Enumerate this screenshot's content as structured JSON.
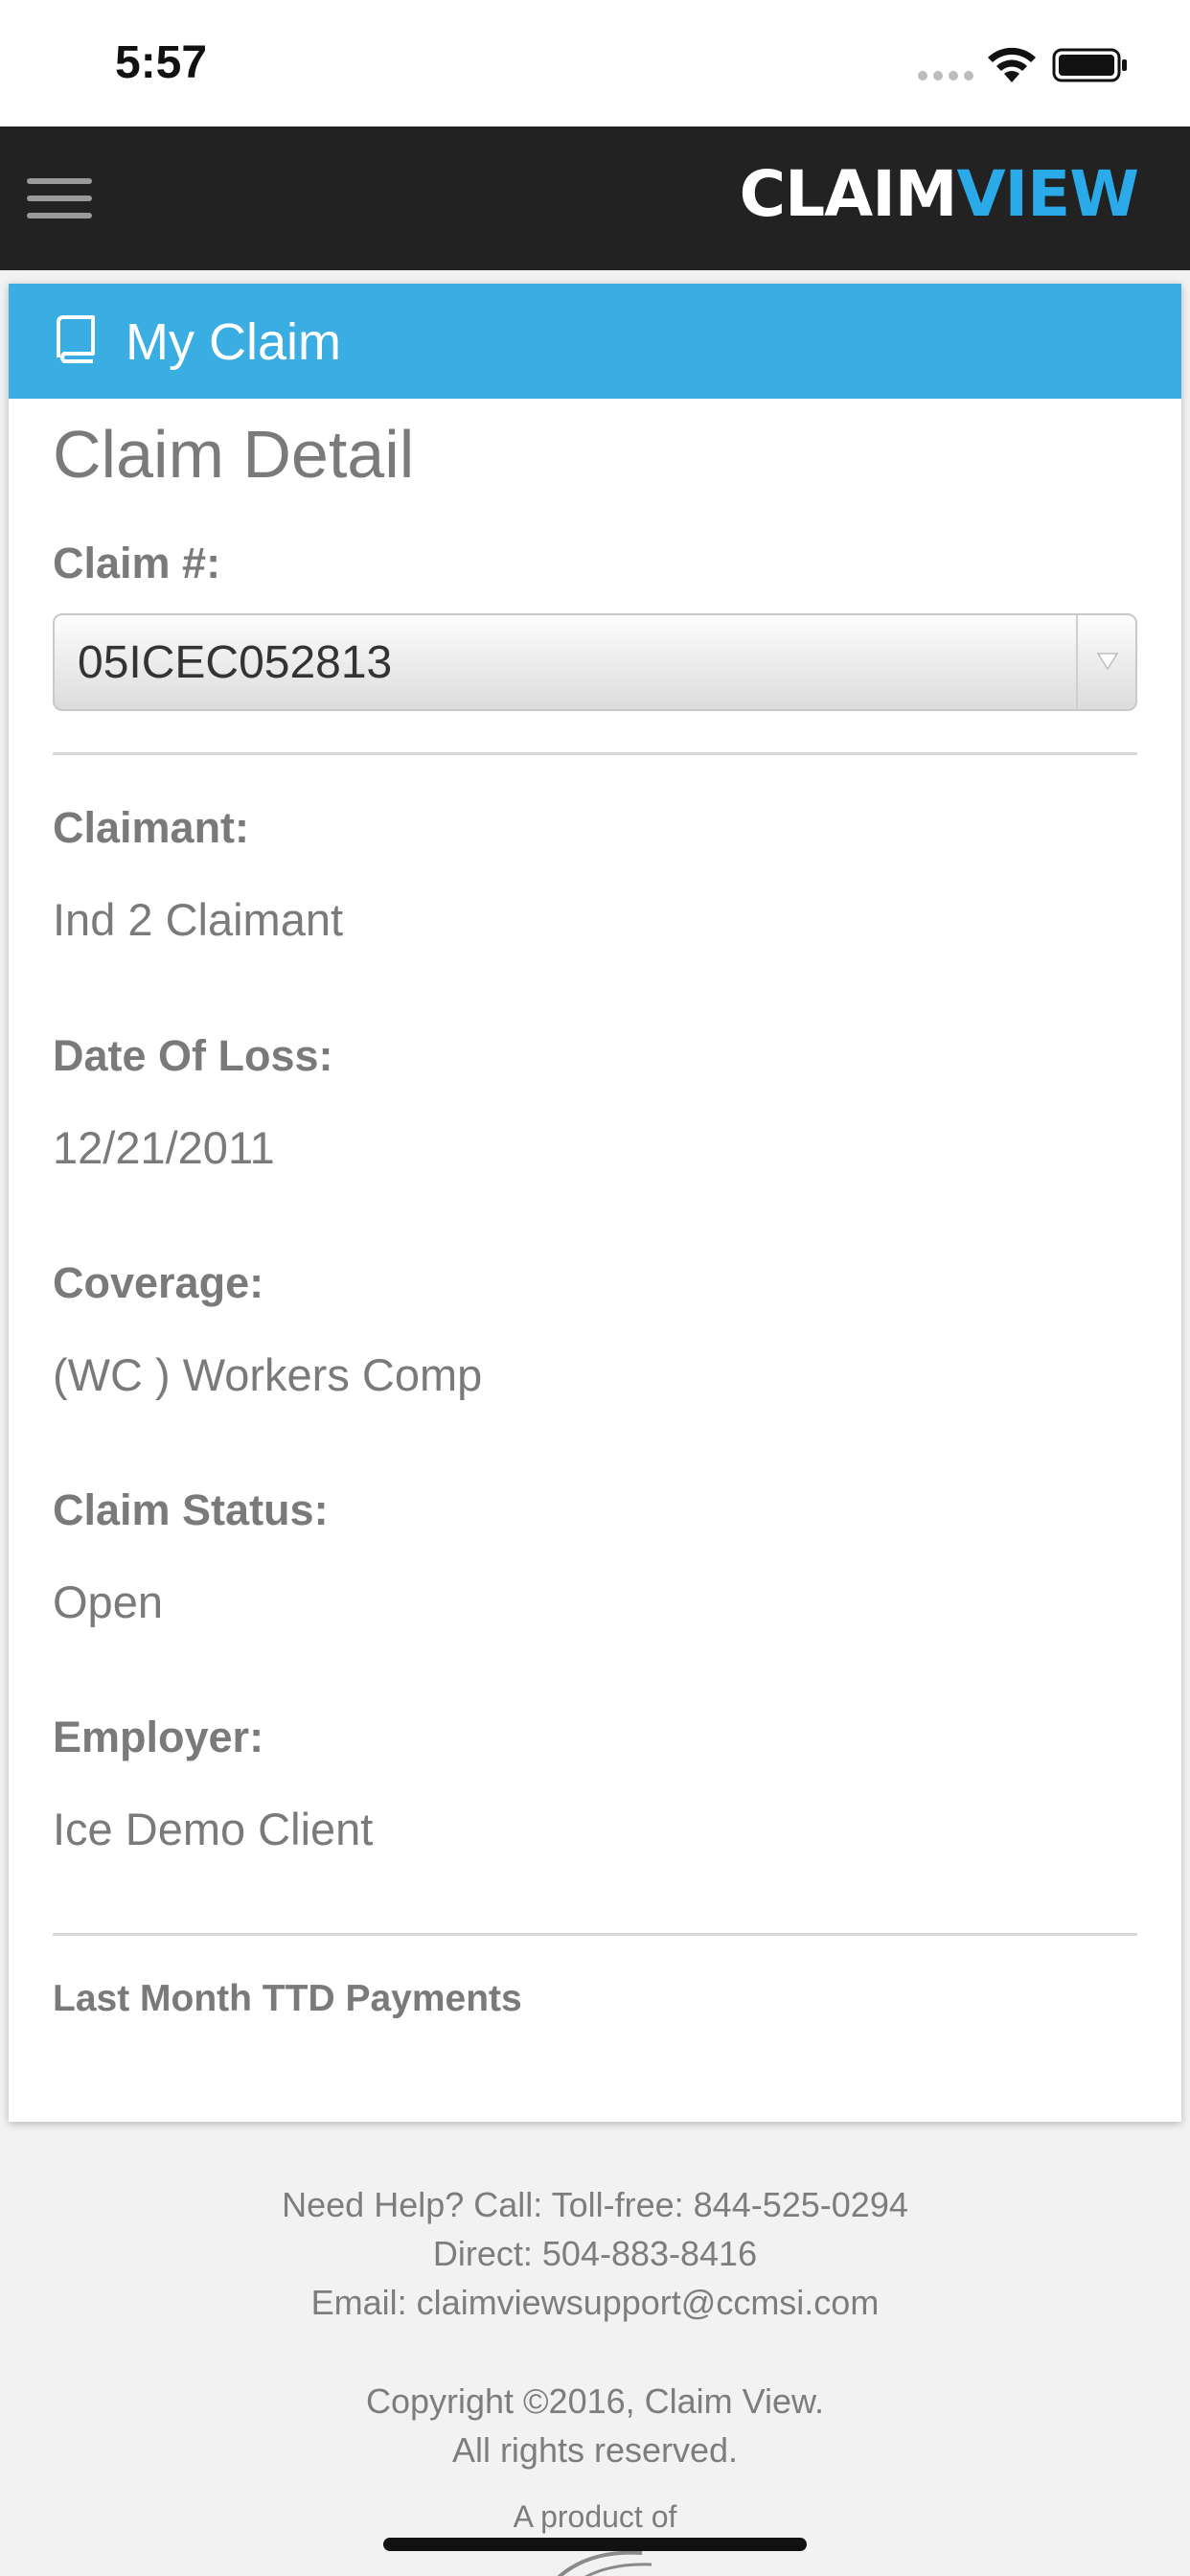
{
  "status_bar": {
    "time": "5:57"
  },
  "header": {
    "brand_part1": "CLAIM",
    "brand_part2": "VIEW"
  },
  "card": {
    "header_title": "My Claim",
    "page_title": "Claim Detail",
    "claim_select": {
      "label": "Claim #:",
      "value": "05ICEC052813"
    },
    "fields": [
      {
        "label": "Claimant:",
        "value": "Ind 2 Claimant"
      },
      {
        "label": "Date Of Loss:",
        "value": "12/21/2011"
      },
      {
        "label": "Coverage:",
        "value": "(WC ) Workers Comp"
      },
      {
        "label": "Claim Status:",
        "value": "Open"
      },
      {
        "label": "Employer:",
        "value": "Ice Demo Client"
      }
    ],
    "section_heading": "Last Month TTD Payments"
  },
  "footer": {
    "help_line": "Need Help? Call: Toll-free: 844-525-0294",
    "direct_line": "Direct: 504-883-8416",
    "email_line": "Email: claimviewsupport@ccmsi.com",
    "copyright_line": "Copyright ©2016, Claim View.",
    "rights_line": "All rights reserved.",
    "product_line": "A product of"
  },
  "colors": {
    "header_bg": "#222222",
    "accent": "#3aade2",
    "brand_blue": "#2aaae8",
    "text_gray": "#7a7a7a"
  },
  "icons": [
    "menu-icon",
    "book-icon",
    "chevron-down-icon",
    "wifi-icon",
    "battery-icon"
  ]
}
